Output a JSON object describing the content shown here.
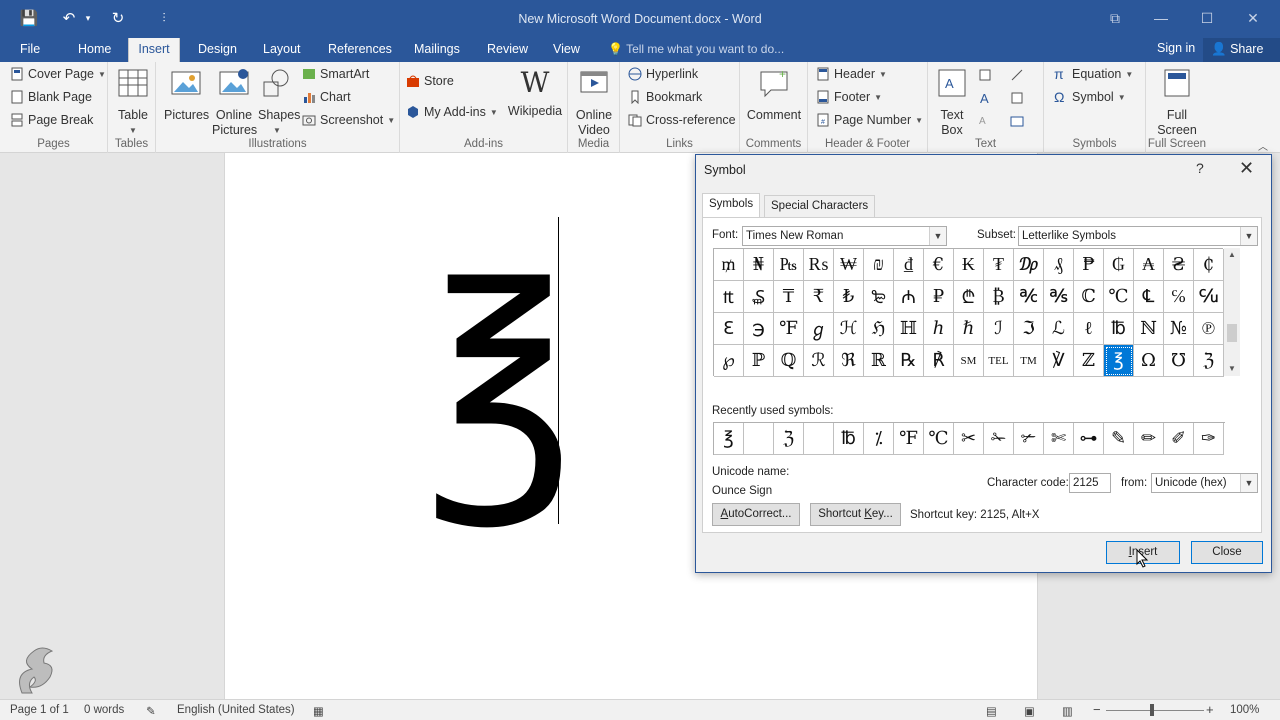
{
  "titlebar": {
    "title": "New Microsoft Word Document.docx - Word",
    "save_glyph": "💾",
    "undo_glyph": "↶",
    "undo_caret": "▾",
    "redo_glyph": "↻",
    "custom_glyph": "⫶",
    "restore_glyph": "⧉",
    "min_glyph": "—",
    "max_glyph": "☐",
    "close_glyph": "✕"
  },
  "tabs": {
    "file": "File",
    "items": [
      "Home",
      "Insert",
      "Design",
      "Layout",
      "References",
      "Mailings",
      "Review",
      "View"
    ],
    "active": "Insert",
    "tellme": "Tell me what you want to do...",
    "signin": "Sign in",
    "share": "Share"
  },
  "ribbon": {
    "pages": {
      "label": "Pages",
      "cover": "Cover Page",
      "blank": "Blank Page",
      "break": "Page Break"
    },
    "tables": {
      "label": "Tables",
      "table": "Table"
    },
    "illustrations": {
      "label": "Illustrations",
      "pictures": "Pictures",
      "online1": "Online",
      "online2": "Pictures",
      "shapes": "Shapes",
      "smartart": "SmartArt",
      "chart": "Chart",
      "screenshot": "Screenshot"
    },
    "addins": {
      "label": "Add-ins",
      "store": "Store",
      "myaddins": "My Add-ins",
      "wikipedia": "Wikipedia",
      "wiki_glyph": "W"
    },
    "media": {
      "label": "Media",
      "video1": "Online",
      "video2": "Video"
    },
    "links": {
      "label": "Links",
      "hyperlink": "Hyperlink",
      "bookmark": "Bookmark",
      "crossref": "Cross-reference"
    },
    "comments": {
      "label": "Comments",
      "comment": "Comment"
    },
    "headerfooter": {
      "label": "Header & Footer",
      "header": "Header",
      "footer": "Footer",
      "pagenumber": "Page Number"
    },
    "text": {
      "label": "Text",
      "textbox1": "Text",
      "textbox2": "Box"
    },
    "symbols": {
      "label": "Symbols",
      "equation": "Equation",
      "symbol": "Symbol",
      "equation_glyph": "π",
      "symbol_glyph": "Ω"
    },
    "fullscreen": {
      "label": "Full Screen",
      "full1": "Full",
      "full2": "Screen"
    }
  },
  "document": {
    "glyph": "℥"
  },
  "dialog": {
    "title": "Symbol",
    "help": "?",
    "close_glyph": "✕",
    "tab_symbols": "Symbols",
    "tab_special": "Special Characters",
    "font_label": "Font:",
    "font_value": "Times New Roman",
    "subset_label": "Subset:",
    "subset_value": "Letterlike Symbols",
    "grid": [
      [
        "₥",
        "₦",
        "₧",
        "₨",
        "₩",
        "₪",
        "₫",
        "€",
        "₭",
        "₮",
        "₯",
        "₰",
        "₱",
        "₲",
        "₳",
        "₴",
        "₵"
      ],
      [
        "₶",
        "₷",
        "₸",
        "₹",
        "₺",
        "₻",
        "₼",
        "₽",
        "₾",
        "₿",
        "℀",
        "℁",
        "ℂ",
        "℃",
        "℄",
        "℅",
        "℆"
      ],
      [
        "ℇ",
        "℈",
        "℉",
        "ℊ",
        "ℋ",
        "ℌ",
        "ℍ",
        "ℎ",
        "ℏ",
        "ℐ",
        "ℑ",
        "ℒ",
        "ℓ",
        "℔",
        "ℕ",
        "№",
        "℗"
      ],
      [
        "℘",
        "ℙ",
        "ℚ",
        "ℛ",
        "ℜ",
        "ℝ",
        "℞",
        "℟",
        "SM",
        "TEL",
        "TM",
        "℣",
        "ℤ",
        "℥",
        "Ω",
        "℧",
        "ℨ"
      ]
    ],
    "selected": "℥",
    "recent_label": "Recently used symbols:",
    "recent": [
      "℥",
      " ",
      "ℨ",
      " ",
      "℔",
      "⁒",
      "℉",
      "℃",
      "✂",
      "✁",
      "✃",
      "✄",
      "⊶",
      "✎",
      "✏",
      "✐",
      "✑"
    ],
    "unicode_name_label": "Unicode name:",
    "unicode_name": "Ounce Sign",
    "charcode_label": "Character code:",
    "charcode_value": "2125",
    "from_label": "from:",
    "from_value": "Unicode (hex)",
    "autocorrect": "AutoCorrect...",
    "shortcut_btn": "Shortcut Key...",
    "shortcut_text": "Shortcut key: 2125, Alt+X",
    "insert": "Insert",
    "close": "Close"
  },
  "status": {
    "page": "Page 1 of 1",
    "words": "0 words",
    "language": "English (United States)",
    "zoom": "100%",
    "minus": "−",
    "plus": "+"
  }
}
